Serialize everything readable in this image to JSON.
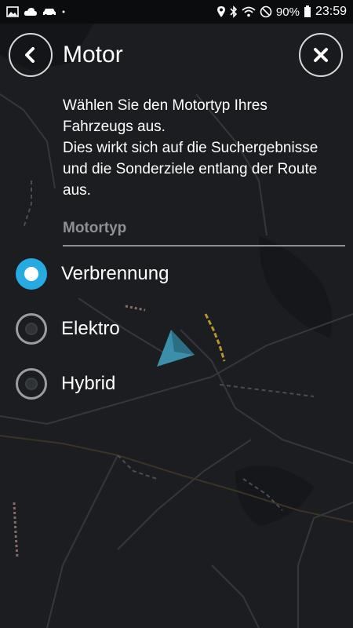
{
  "status_bar": {
    "battery": "90%",
    "time": "23:59"
  },
  "header": {
    "title": "Motor"
  },
  "description_lines": [
    "Wählen Sie den Motortyp Ihres",
    "Fahrzeugs aus.",
    "Dies wirkt sich auf die Suchergebnisse",
    "und die Sonderziele entlang der Route",
    "aus."
  ],
  "section": {
    "label": "Motortyp"
  },
  "options": [
    {
      "label": "Verbrennung",
      "selected": true
    },
    {
      "label": "Elektro",
      "selected": false
    },
    {
      "label": "Hybrid",
      "selected": false
    }
  ],
  "colors": {
    "accent": "#27a9e1",
    "map_background": "#1b1d20",
    "secondary_text": "#8d9196",
    "position_arrow": "#3b8fa8"
  }
}
